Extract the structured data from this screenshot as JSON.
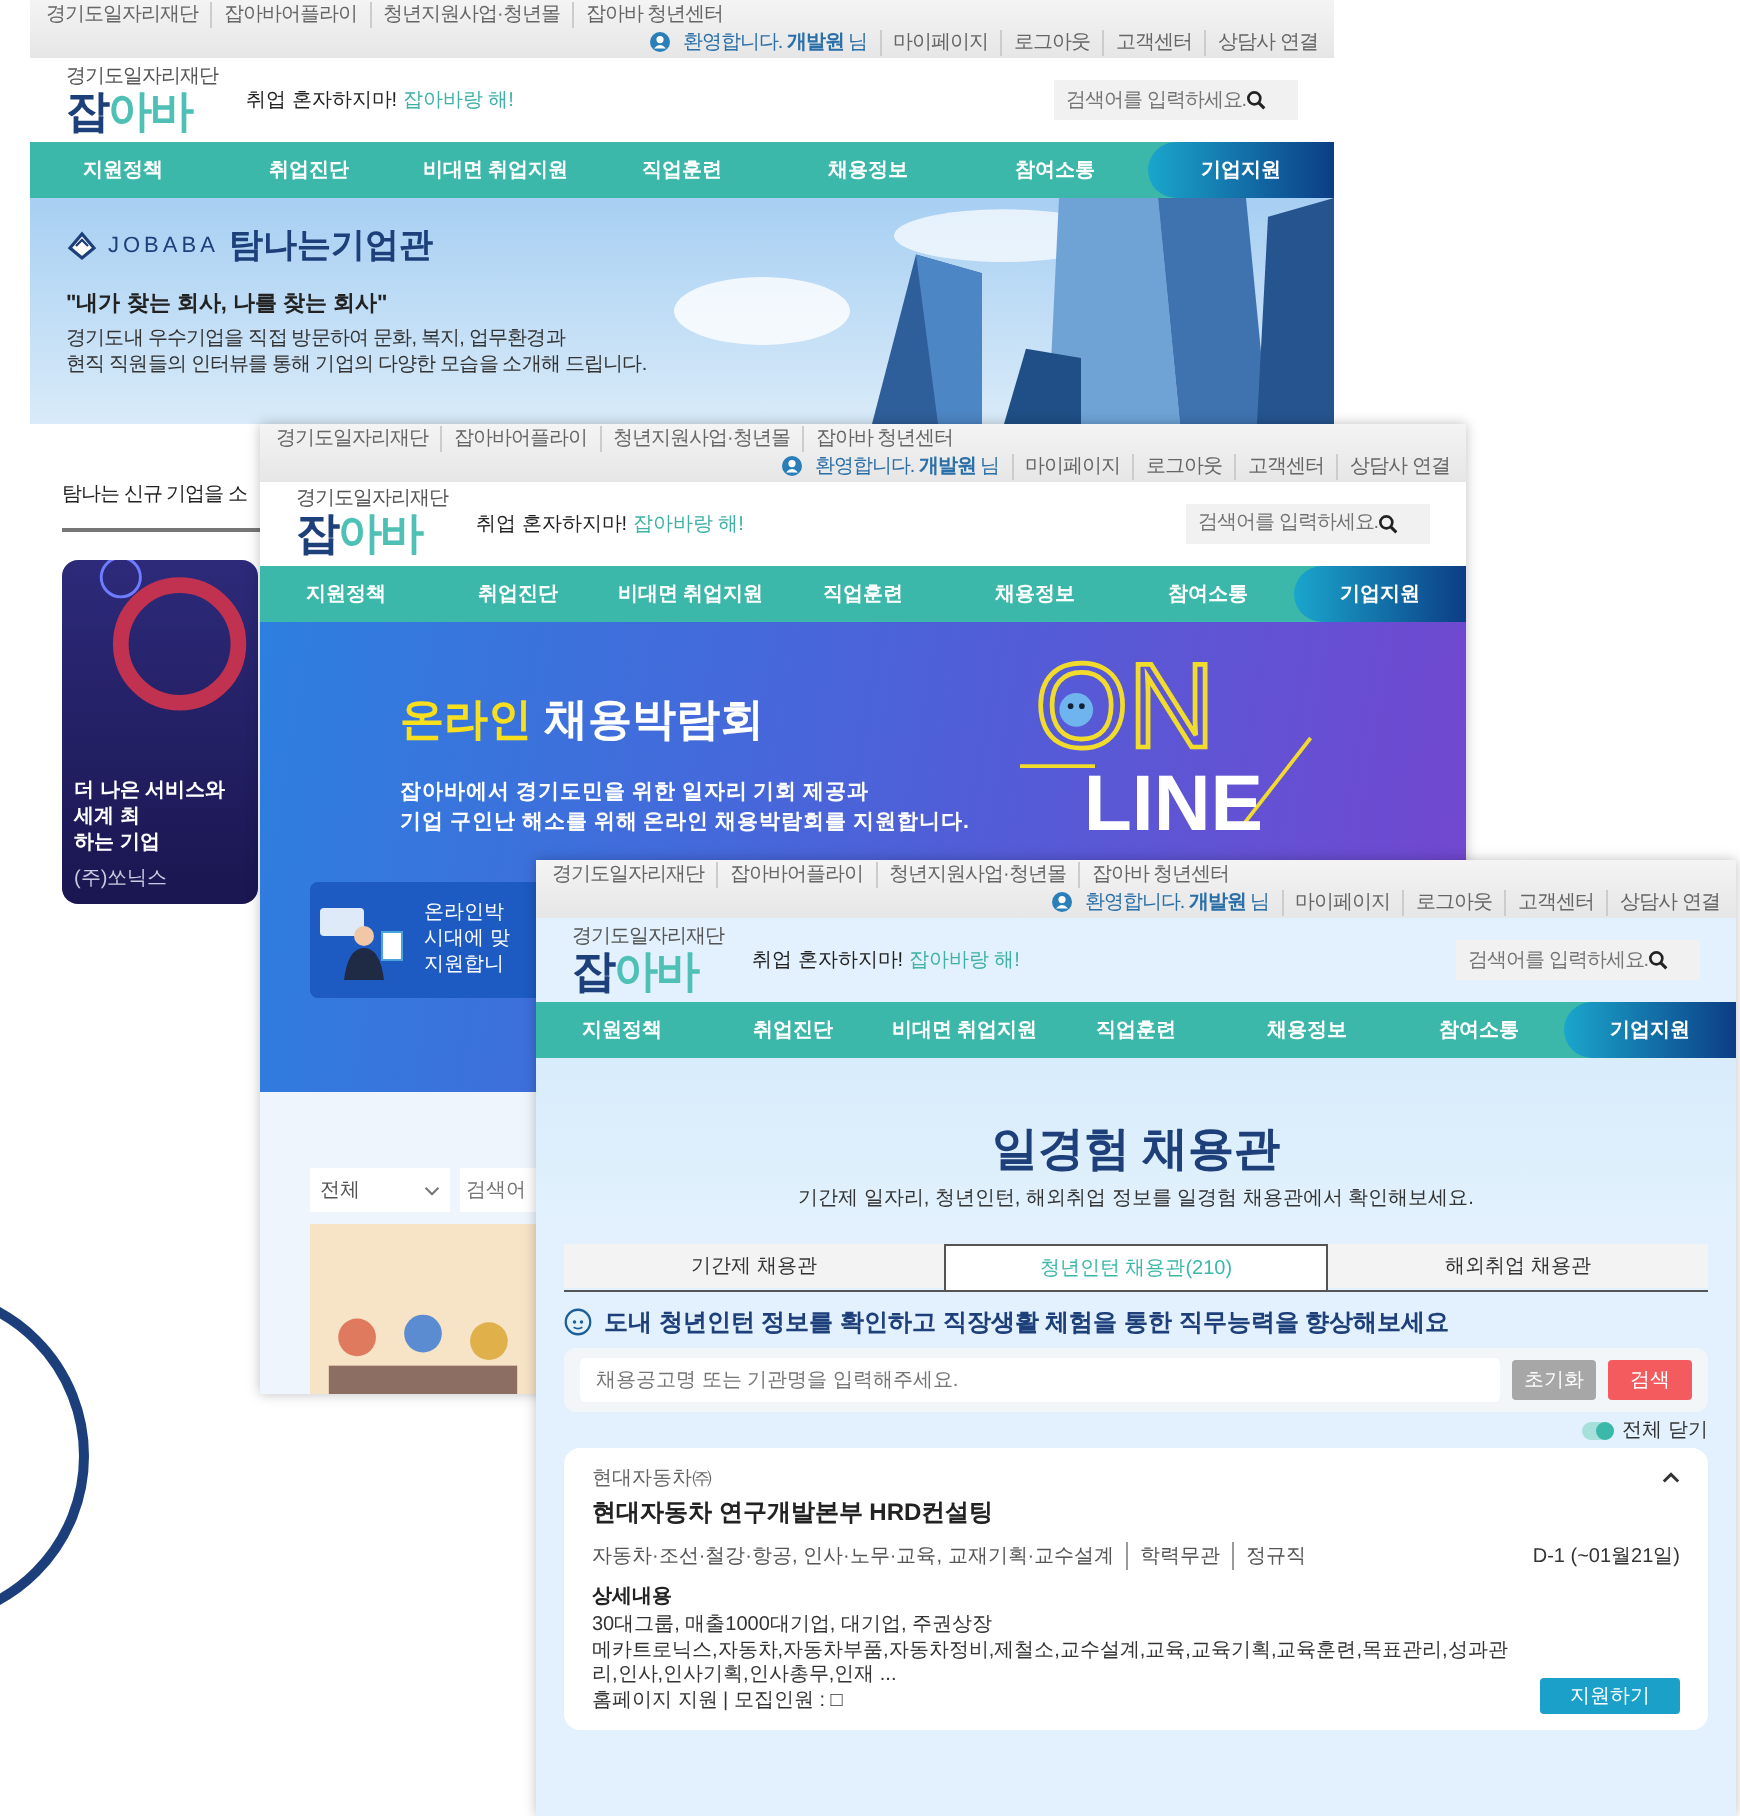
{
  "window_1": {
    "header": {
      "top_links": [
        "경기도일자리재단",
        "잡아바어플라이",
        "청년지원사업·청년몰",
        "잡아바 청년센터"
      ],
      "greeting": "환영합니다. **개발원** 님",
      "account_links": [
        "마이페이지",
        "로그아웃",
        "고객센터",
        "상담사 연결"
      ],
      "logo_caption": "경기도일자리재단",
      "logo_parts": [
        "잡",
        "아바"
      ],
      "slogan": "취업 혼자하지마! ",
      "slogan_highlight": "잡아바랑 해!",
      "search": {
        "placeholder": "검색어를 입력하세요."
      },
      "nav": [
        {
          "label": "지원정책",
          "selected": false
        },
        {
          "label": "취업진단",
          "selected": false
        },
        {
          "label": "비대면 취업지원",
          "selected": false
        },
        {
          "label": "직업훈련",
          "selected": false
        },
        {
          "label": "채용정보",
          "selected": false
        },
        {
          "label": "참여소통",
          "selected": false
        },
        {
          "label": "기업지원",
          "selected": true
        }
      ]
    },
    "banner": {
      "brand": "JOBABA",
      "title": "탐나는기업관",
      "quote": "\"내가 찾는 회사, 나를 찾는 회사\"",
      "description": [
        "경기도내 우수기업을 직접 방문하여 문화, 복지, 업무환경과",
        "현직 직원들의 인터뷰를 통해 기업의 다양한 모습을 소개해 드립니다."
      ]
    },
    "section_title": "탐나는 신규 기업을 소",
    "card": {
      "lines": [
        "더 나은 서비스와 세계 최",
        "하는 기업"
      ],
      "company": "(주)쏘닉스"
    }
  },
  "window_2": {
    "header": {
      "top_links": [
        "경기도일자리재단",
        "잡아바어플라이",
        "청년지원사업·청년몰",
        "잡아바 청년센터"
      ],
      "greeting": "환영합니다. **개발원** 님",
      "account_links": [
        "마이페이지",
        "로그아웃",
        "고객센터",
        "상담사 연결"
      ],
      "logo_caption": "경기도일자리재단",
      "logo_parts": [
        "잡",
        "아바"
      ],
      "slogan": "취업 혼자하지마! ",
      "slogan_highlight": "잡아바랑 해!",
      "search": {
        "placeholder": "검색어를 입력하세요."
      },
      "nav": [
        {
          "label": "지원정책",
          "selected": false
        },
        {
          "label": "취업진단",
          "selected": false
        },
        {
          "label": "비대면 취업지원",
          "selected": false
        },
        {
          "label": "직업훈련",
          "selected": false
        },
        {
          "label": "채용정보",
          "selected": false
        },
        {
          "label": "참여소통",
          "selected": false
        },
        {
          "label": "기업지원",
          "selected": true
        }
      ]
    },
    "banner": {
      "title_highlight": "온라인",
      "title": "채용박람회",
      "description": [
        "잡아바에서 경기도민을 위한 일자리 기회 제공과",
        "기업 구인난 해소를 위해 온라인 채용박람회를 지원합니다."
      ],
      "art_top": "ON",
      "art_bottom": "LINE"
    },
    "notice": {
      "lines": [
        "온라인박",
        "시대에 맞",
        "지원합니"
      ]
    },
    "filter": {
      "category": "전체",
      "search_placeholder": "검색어"
    }
  },
  "window_3": {
    "header": {
      "top_links": [
        "경기도일자리재단",
        "잡아바어플라이",
        "청년지원사업·청년몰",
        "잡아바 청년센터"
      ],
      "greeting": "환영합니다. **개발원** 님",
      "account_links": [
        "마이페이지",
        "로그아웃",
        "고객센터",
        "상담사 연결"
      ],
      "logo_caption": "경기도일자리재단",
      "logo_parts": [
        "잡",
        "아바"
      ],
      "slogan": "취업 혼자하지마! ",
      "slogan_highlight": "잡아바랑 해!",
      "search": {
        "placeholder": "검색어를 입력하세요."
      },
      "nav": [
        {
          "label": "지원정책",
          "selected": false
        },
        {
          "label": "취업진단",
          "selected": false
        },
        {
          "label": "비대면 취업지원",
          "selected": false
        },
        {
          "label": "직업훈련",
          "selected": false
        },
        {
          "label": "채용정보",
          "selected": false
        },
        {
          "label": "참여소통",
          "selected": false
        },
        {
          "label": "기업지원",
          "selected": true
        }
      ]
    },
    "hero": {
      "title": "일경험 채용관",
      "subtitle": "기간제 일자리, 청년인턴, 해외취업 정보를 일경험 채용관에서 확인해보세요."
    },
    "tabs": [
      {
        "label": "기간제 채용관",
        "selected": false
      },
      {
        "label": "청년인턴 채용관(210)",
        "selected": true
      },
      {
        "label": "해외취업 채용관",
        "selected": false
      }
    ],
    "intro": "도내 청년인턴 정보를 확인하고 직장생활 체험을 통한 직무능력을 향상해보세요",
    "search": {
      "placeholder": "채용공고명 또는 기관명을 입력해주세요.",
      "reset_button": "초기화",
      "search_button": "검색"
    },
    "toggle": {
      "label": "전체 닫기",
      "on": true
    },
    "job": {
      "company": "현대자동차㈜",
      "title": "현대자동차 연구개발본부 HRD컨설팅",
      "expanded": true,
      "tags": [
        "자동차·조선·철강·항공, 인사·노무·교육, 교재기획·교수설계",
        "학력무관",
        "정규직"
      ],
      "deadline": "D-1 (~01월21일)",
      "detail_heading": "상세내용",
      "detail_lines": [
        "30대그룹, 매출1000대기업, 대기업, 주권상장",
        "메카트로닉스,자동차,자동차부품,자동차정비,제철소,교수설계,교육,교육기획,교육훈련,목표관리,성과관리,인사,인사기획,인사총무,인재 ...",
        "홈페이지 지원 | 모집인원 : □"
      ],
      "apply": "지원하기"
    }
  }
}
